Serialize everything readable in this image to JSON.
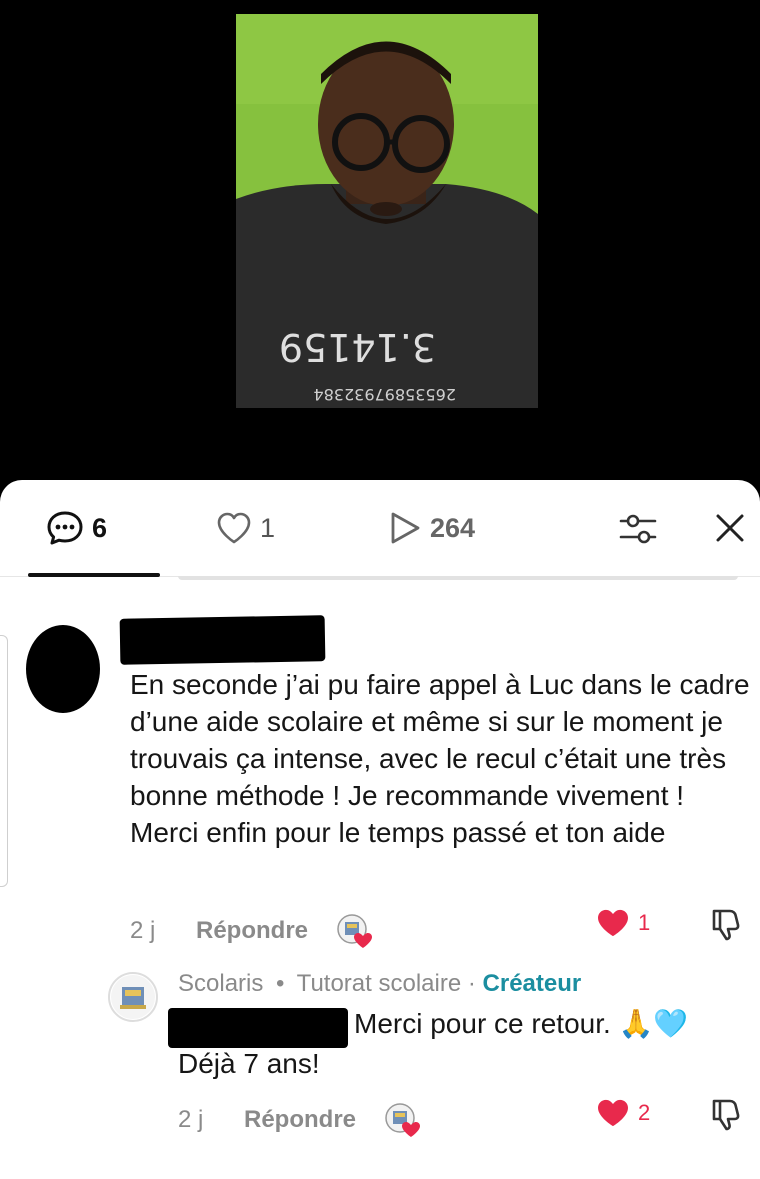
{
  "tabs": {
    "comments_count": "6",
    "likes_count": "1",
    "views_count": "264"
  },
  "comment": {
    "text": "En seconde j’ai pu faire appel à Luc dans le cadre d’une aide scolaire et même si sur le moment je trouvais ça intense, avec le recul c’était une très bonne méthode ! Je recommande vivement ! Merci enfin pour le temps passé et ton aide",
    "time": "2 j",
    "reply_label": "Répondre",
    "like_count": "1"
  },
  "reply": {
    "author": "Scolaris",
    "author_subtitle": "Tutorat scolaire",
    "separator": "•",
    "creator_separator": "·",
    "creator_label": "Créateur",
    "text_line1": "Merci pour ce retour. 🙏🩵",
    "text_line2": "Déjà 7 ans!",
    "time": "2 j",
    "reply_label": "Répondre",
    "like_count": "2"
  },
  "colors": {
    "like_red": "#e8294c",
    "creator_teal": "#1b8ea0",
    "video_bg": "#86c13e"
  },
  "icons": [
    "comment-bubble-icon",
    "heart-outline-icon",
    "play-icon",
    "filter-sliders-icon",
    "close-icon",
    "heart-filled-icon",
    "thumbs-down-icon",
    "creator-badge-icon"
  ]
}
